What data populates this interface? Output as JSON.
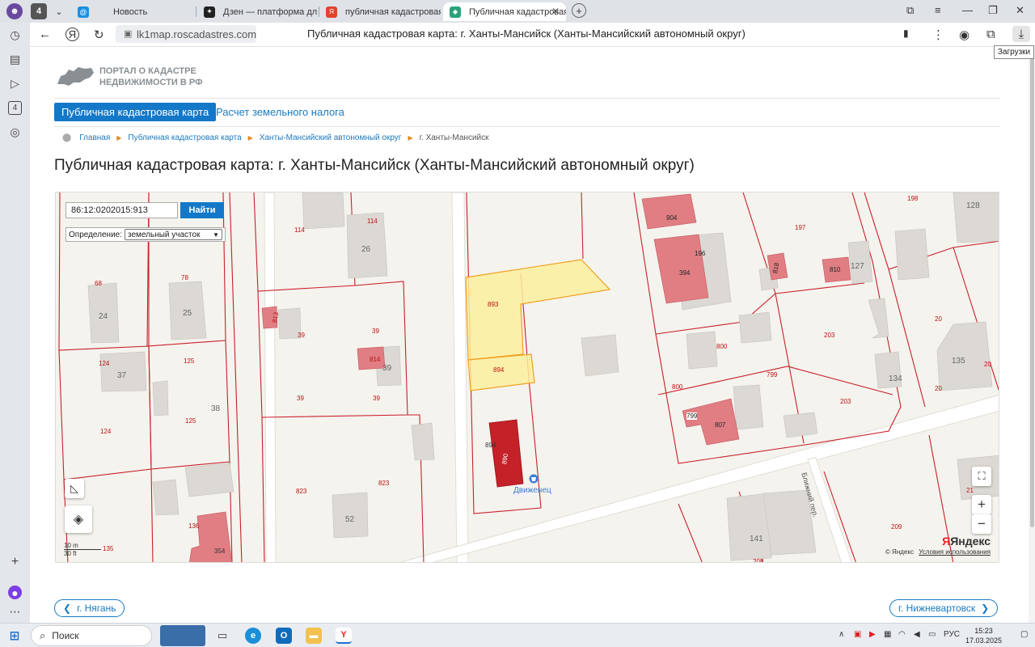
{
  "browser": {
    "profile_badge": "4",
    "tabs": [
      {
        "label": "Новость",
        "favicon": "@"
      },
      {
        "label": "Дзен — платформа для п",
        "favicon": "✦"
      },
      {
        "label": "публичная кадастровая к",
        "favicon": "Я"
      },
      {
        "label": "Публичная кадастровая ка",
        "favicon": "◆"
      }
    ],
    "url": "lk1map.roscadastres.com",
    "title": "Публичная кадастровая карта: г. Ханты-Мансийск (Ханты-Мансийский автономный округ)",
    "tooltip_downloads": "Загрузки"
  },
  "site": {
    "logo_line1": "ПОРТАЛ О КАДАСТРЕ",
    "logo_line2": "НЕДВИЖИМОСТИ В РФ",
    "menu": {
      "cadastral_map": "Публичная кадастровая карта",
      "land_tax": "Расчет земельного налога"
    },
    "breadcrumbs": [
      "Главная",
      "Публичная кадастровая карта",
      "Ханты-Мансийский автономный округ",
      "г. Ханты-Мансийск"
    ],
    "heading": "Публичная кадастровая карта: г. Ханты-Мансийск (Ханты-Мансийский автономный округ)"
  },
  "map": {
    "search_value": "86:12:0202015:913",
    "search_button": "Найти",
    "definition_label": "Определение:",
    "definition_value": "земельный участок",
    "scale_metric": "10 m",
    "scale_imperial": "30 ft",
    "copyright": "© Яндекс",
    "terms": "Условия использования",
    "brand": "Яндекс",
    "poi": "Движенец",
    "street": "Ближний пер.",
    "zoom_in": "+",
    "zoom_out": "−",
    "parcel_labels": {
      "p68": "68",
      "p78": "78",
      "p114a": "114",
      "p114b": "114",
      "p24": "24",
      "p25": "25",
      "p26": "26",
      "p124a": "124",
      "p124b": "124",
      "p125a": "125",
      "p125b": "125",
      "p37": "37",
      "p38": "38",
      "p39a": "39",
      "p39b": "39",
      "p39c": "39",
      "p39d": "39",
      "p39e": "39",
      "p39f": "39",
      "p823a": "823",
      "p823b": "823",
      "p52": "52",
      "p136": "136",
      "p135": "135",
      "p354": "354",
      "p893": "893",
      "p894a": "894",
      "p894b": "894",
      "p890": "890",
      "p904": "904",
      "p196": "196",
      "p394": "394",
      "p197": "197",
      "p818": "818",
      "p810": "810",
      "p127": "127",
      "p198": "198",
      "p128": "128",
      "p20a": "20",
      "p20b": "20",
      "p20c": "20",
      "p135b": "135",
      "p203a": "203",
      "p203b": "203",
      "p134": "134",
      "p800a": "800",
      "p800b": "800",
      "p799a": "799",
      "p799b": "799",
      "p807": "807",
      "p141": "141",
      "p209": "209",
      "p208": "208",
      "p21": "21",
      "p814": "814",
      "p813": "813"
    }
  },
  "pager": {
    "prev": "г. Нягань",
    "next": "г. Нижневартовск"
  },
  "taskbar": {
    "search": "Поиск",
    "lang": "РУС",
    "time": "15:23",
    "date": "17.03.2025"
  }
}
